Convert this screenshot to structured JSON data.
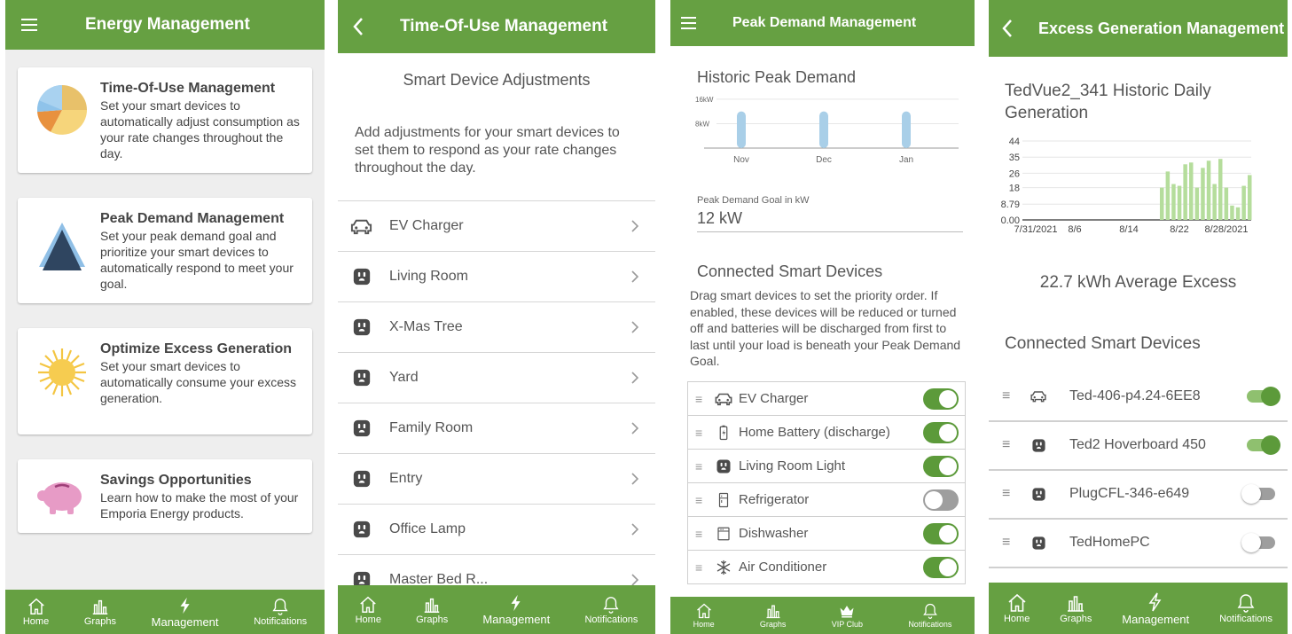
{
  "screen1": {
    "title": "Energy Management",
    "cards": [
      {
        "title": "Time-Of-Use Management",
        "desc": "Set your smart devices to automatically adjust consumption as your rate changes throughout the day."
      },
      {
        "title": "Peak Demand Management",
        "desc": "Set your peak demand goal and prioritize your smart devices to automatically respond to meet your goal."
      },
      {
        "title": "Optimize Excess Generation",
        "desc": "Set your smart devices to automatically consume your excess generation."
      },
      {
        "title": "Savings Opportunities",
        "desc": "Learn how to make the most of your Emporia Energy products."
      }
    ],
    "nav": [
      "Home",
      "Graphs",
      "Management",
      "Notifications"
    ]
  },
  "screen2": {
    "title": "Time-Of-Use Management",
    "subtitle": "Smart Device Adjustments",
    "intro": "Add adjustments for your smart devices to set them to respond as your rate changes throughout the day.",
    "devices": [
      "EV Charger",
      "Living Room",
      "X-Mas Tree",
      "Yard",
      "Family Room",
      "Entry",
      "Office Lamp",
      "Master Bed R..."
    ],
    "nav": [
      "Home",
      "Graphs",
      "Management",
      "Notifications"
    ]
  },
  "screen3": {
    "title": "Peak Demand Management",
    "chart_title": "Historic Peak Demand",
    "chart_data": {
      "type": "bar",
      "categories": [
        "Nov",
        "Dec",
        "Jan"
      ],
      "values": [
        12,
        12,
        12
      ],
      "yticks": [
        "16kW",
        "8kW"
      ],
      "ytick_values": [
        16,
        8
      ],
      "ylim": [
        0,
        18
      ],
      "color": "#a9cfe8"
    },
    "goal_label": "Peak Demand Goal in kW",
    "goal_value": "12 kW",
    "devices_title": "Connected Smart Devices",
    "devices_desc": "Drag smart devices to set the priority order. If enabled, these devices will be reduced or turned off and batteries will be discharged from first to last until your load is beneath your Peak Demand Goal.",
    "devices": [
      {
        "name": "EV Charger",
        "icon": "car-icon",
        "on": true
      },
      {
        "name": "Home Battery (discharge)",
        "icon": "battery-icon",
        "on": true
      },
      {
        "name": "Living Room Light",
        "icon": "plug-icon",
        "on": true
      },
      {
        "name": "Refrigerator",
        "icon": "refrigerator-icon",
        "on": false
      },
      {
        "name": "Dishwasher",
        "icon": "dishwasher-icon",
        "on": true
      },
      {
        "name": "Air Conditioner",
        "icon": "snowflake-icon",
        "on": true
      }
    ],
    "nav": [
      "Home",
      "Graphs",
      "VIP Club",
      "Notifications"
    ]
  },
  "screen4": {
    "title": "Excess Generation Management",
    "chart_title": "TedVue2_341 Historic Daily Generation",
    "chart_data": {
      "type": "bar",
      "yticks": [
        "44",
        "35",
        "26",
        "18",
        "8.79",
        "0.00"
      ],
      "ytick_values": [
        44,
        35,
        26,
        18,
        8.79,
        0
      ],
      "xticks": [
        "7/31/2021",
        "8/6",
        "8/14",
        "8/22",
        "8/28/2021"
      ],
      "values": [
        18,
        27,
        20,
        19,
        31,
        32,
        18,
        29,
        33,
        20,
        34,
        18,
        8,
        7,
        19,
        25
      ],
      "ylim": [
        0,
        44
      ],
      "color": "#b5dd9c"
    },
    "average": "22.7 kWh Average Excess",
    "devices_title": "Connected Smart Devices",
    "devices": [
      {
        "name": "Ted-406-p4.24-6EE8",
        "icon": "car-icon",
        "on": true
      },
      {
        "name": "Ted2 Hoverboard 450",
        "icon": "plug-icon",
        "on": true
      },
      {
        "name": "PlugCFL-346-e649",
        "icon": "plug-icon",
        "on": false
      },
      {
        "name": "TedHomePC",
        "icon": "plug-icon",
        "on": false
      }
    ],
    "nav": [
      "Home",
      "Graphs",
      "Management",
      "Notifications"
    ]
  }
}
